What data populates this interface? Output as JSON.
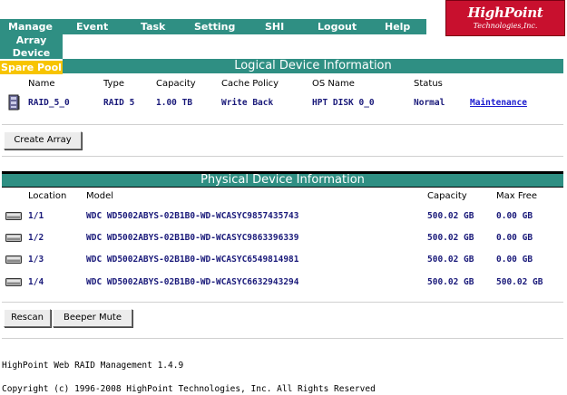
{
  "nav": {
    "items": [
      "Manage",
      "Event",
      "Task",
      "Setting",
      "SHI",
      "Logout",
      "Help"
    ],
    "manage_sub": [
      "Array",
      "Device"
    ],
    "spare_pool": "Spare Pool"
  },
  "logo": {
    "main": "HighPoint",
    "sub": "Technologies,Inc."
  },
  "logical": {
    "title": "Logical Device Information",
    "headers": [
      "Name",
      "Type",
      "Capacity",
      "Cache Policy",
      "OS Name",
      "Status"
    ],
    "row": {
      "name": "RAID_5_0",
      "type": "RAID 5",
      "capacity": "1.00 TB",
      "cache_policy": "Write Back",
      "os_name": "HPT DISK 0_0",
      "status": "Normal",
      "action": "Maintenance"
    }
  },
  "buttons": {
    "create_array": "Create Array",
    "rescan": "Rescan",
    "beeper_mute": "Beeper Mute"
  },
  "physical": {
    "title": "Physical Device Information",
    "headers": [
      "Location",
      "Model",
      "Capacity",
      "Max Free"
    ],
    "rows": [
      {
        "location": "1/1",
        "model": "WDC WD5002ABYS-02B1B0-WD-WCASYC9857435743",
        "capacity": "500.02 GB",
        "max_free": "0.00 GB"
      },
      {
        "location": "1/2",
        "model": "WDC WD5002ABYS-02B1B0-WD-WCASYC9863396339",
        "capacity": "500.02 GB",
        "max_free": "0.00 GB"
      },
      {
        "location": "1/3",
        "model": "WDC WD5002ABYS-02B1B0-WD-WCASYC6549814981",
        "capacity": "500.02 GB",
        "max_free": "0.00 GB"
      },
      {
        "location": "1/4",
        "model": "WDC WD5002ABYS-02B1B0-WD-WCASYC6632943294",
        "capacity": "500.02 GB",
        "max_free": "500.02 GB"
      }
    ]
  },
  "footer": {
    "version": "HighPoint Web RAID Management 1.4.9",
    "copyright": "Copyright (c) 1996-2008 HighPoint Technologies, Inc. All Rights Reserved"
  },
  "colors": {
    "nav_bg": "#2f8f83",
    "spare_pool_bg": "#f7c400",
    "logo_bg": "#c8102e",
    "value_text": "#1a1a7a",
    "link": "#1b1bcf"
  },
  "icons": {
    "array": "raid-array-icon",
    "disk": "hard-disk-icon"
  }
}
